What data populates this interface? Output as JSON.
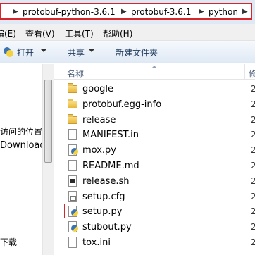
{
  "address": {
    "items": [
      "protobuf-python-3.6.1",
      "protobuf-3.6.1",
      "python"
    ],
    "separator": "▶"
  },
  "menubar": {
    "items": [
      "编(E)",
      "查看(V)",
      "工具(T)",
      "帮助(H)"
    ]
  },
  "toolbar": {
    "open_label": "打开",
    "share_label": "共享",
    "new_folder_label": "新建文件夹"
  },
  "nav": {
    "items": [
      "访问的位置",
      "Downloads",
      "下载"
    ]
  },
  "filelist": {
    "columns": {
      "name": "名称",
      "date": "修"
    },
    "rows": [
      {
        "name": "google",
        "type": "folder",
        "date": "2"
      },
      {
        "name": "protobuf.egg-info",
        "type": "folder",
        "date": "2"
      },
      {
        "name": "release",
        "type": "folder",
        "date": "2"
      },
      {
        "name": "MANIFEST.in",
        "type": "file",
        "date": "2"
      },
      {
        "name": "mox.py",
        "type": "python",
        "date": "2"
      },
      {
        "name": "README.md",
        "type": "file",
        "date": "2"
      },
      {
        "name": "release.sh",
        "type": "script",
        "date": "2"
      },
      {
        "name": "setup.cfg",
        "type": "config",
        "date": "2"
      },
      {
        "name": "setup.py",
        "type": "python",
        "date": "2",
        "highlighted": true
      },
      {
        "name": "stubout.py",
        "type": "python",
        "date": "2"
      },
      {
        "name": "tox.ini",
        "type": "file",
        "date": "2"
      }
    ]
  },
  "colors": {
    "highlight_border": "#d6262a",
    "toolbar_text": "#1e395b"
  }
}
